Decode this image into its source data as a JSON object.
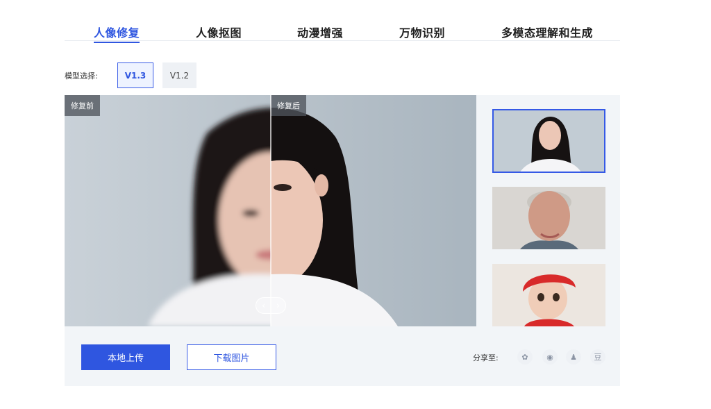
{
  "tabs": [
    {
      "label": "人像修复",
      "active": true
    },
    {
      "label": "人像抠图",
      "active": false
    },
    {
      "label": "动漫增强",
      "active": false
    },
    {
      "label": "万物识别",
      "active": false
    },
    {
      "label": "多模态理解和生成",
      "active": false
    }
  ],
  "model": {
    "label": "模型选择:",
    "options": [
      "V1.3",
      "V1.2"
    ],
    "selected": "V1.3"
  },
  "compare": {
    "before_label": "修复前",
    "after_label": "修复后",
    "slider_left": "‹",
    "slider_right": "›"
  },
  "thumbnails": [
    {
      "name": "young-woman",
      "selected": true
    },
    {
      "name": "older-man",
      "selected": false
    },
    {
      "name": "baby-red-hat",
      "selected": false
    }
  ],
  "actions": {
    "upload": "本地上传",
    "download": "下载图片"
  },
  "share": {
    "label": "分享至:",
    "icons": [
      {
        "name": "moments-icon",
        "glyph": "✿"
      },
      {
        "name": "weibo-icon",
        "glyph": "◉"
      },
      {
        "name": "qq-icon",
        "glyph": "♟"
      },
      {
        "name": "douban-icon",
        "glyph": "豆"
      }
    ]
  },
  "colors": {
    "accent": "#2f56e0",
    "panel_bg": "#f2f5f8"
  }
}
